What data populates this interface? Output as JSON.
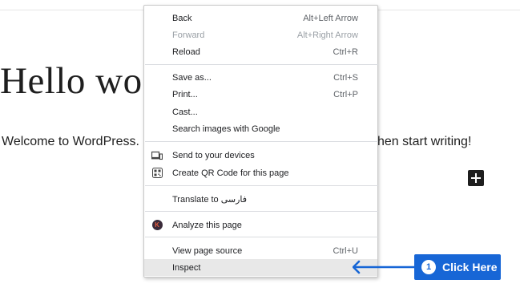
{
  "page": {
    "heading": "Hello wo",
    "body_left": "Welcome to WordPress.",
    "body_right": "hen start writing!"
  },
  "context_menu": {
    "items": [
      {
        "label": "Back",
        "shortcut": "Alt+Left Arrow",
        "enabled": true
      },
      {
        "label": "Forward",
        "shortcut": "Alt+Right Arrow",
        "enabled": false
      },
      {
        "label": "Reload",
        "shortcut": "Ctrl+R",
        "enabled": true
      },
      {
        "label": "Save as...",
        "shortcut": "Ctrl+S",
        "enabled": true
      },
      {
        "label": "Print...",
        "shortcut": "Ctrl+P",
        "enabled": true
      },
      {
        "label": "Cast...",
        "shortcut": "",
        "enabled": true
      },
      {
        "label": "Search images with Google",
        "shortcut": "",
        "enabled": true
      },
      {
        "label": "Send to your devices",
        "shortcut": "",
        "enabled": true,
        "icon": "devices-icon"
      },
      {
        "label": "Create QR Code for this page",
        "shortcut": "",
        "enabled": true,
        "icon": "qr-code-icon"
      },
      {
        "label": "Translate to فارسی",
        "shortcut": "",
        "enabled": true
      },
      {
        "label": "Analyze this page",
        "shortcut": "",
        "enabled": true,
        "icon": "extension-k-icon"
      },
      {
        "label": "View page source",
        "shortcut": "Ctrl+U",
        "enabled": true
      },
      {
        "label": "Inspect",
        "shortcut": "",
        "enabled": true,
        "highlighted": true
      }
    ],
    "extension_icon_letter": "K"
  },
  "annotation": {
    "step_number": "1",
    "label": "Click Here",
    "color": "#1766d6"
  }
}
